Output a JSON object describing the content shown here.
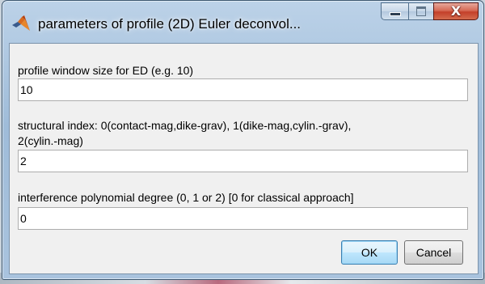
{
  "window": {
    "title": "parameters of profile (2D) Euler deconvol...",
    "app_icon": "matlab-logo-icon",
    "controls": {
      "minimize_icon": "minimize-icon",
      "maximize_icon": "maximize-icon",
      "close_icon": "close-icon",
      "close_glyph": "X"
    }
  },
  "form": {
    "fields": [
      {
        "label_lines": [
          "profile window size for ED (e.g. 10)"
        ],
        "value": "10"
      },
      {
        "label_lines": [
          "structural index: 0(contact-mag,dike-grav), 1(dike-mag,cylin.-grav),",
          "2(cylin.-mag)"
        ],
        "value": "2"
      },
      {
        "label_lines": [
          "interference polynomial degree (0, 1 or 2) [0 for classical approach]"
        ],
        "value": "0"
      }
    ]
  },
  "buttons": {
    "ok_label": "OK",
    "cancel_label": "Cancel"
  },
  "colors": {
    "titlebar": "#a9c3de",
    "close_button": "#c4402a",
    "ok_border": "#3c7fb1"
  }
}
